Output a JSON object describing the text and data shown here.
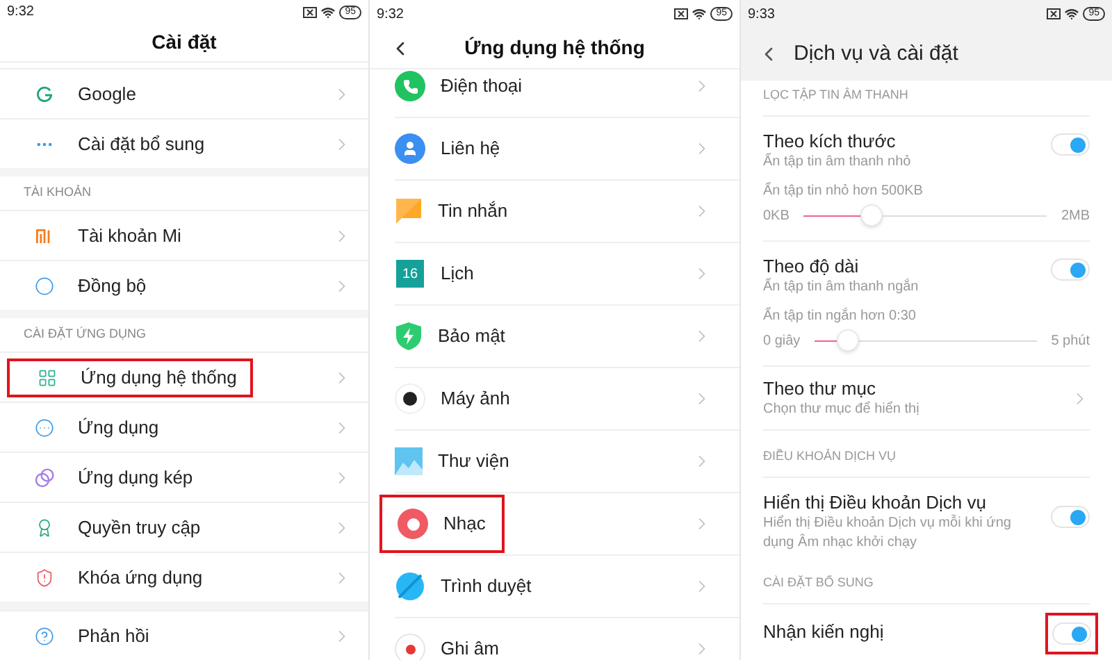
{
  "settings_screen": {
    "status_bar": {
      "time": "9:32",
      "battery": "95"
    },
    "title": "Cài đặt",
    "groups": [
      {
        "items": [
          {
            "label": "Google",
            "highlighted": false
          },
          {
            "label": "Cài đặt bổ sung",
            "highlighted": false
          }
        ]
      },
      {
        "header": "TÀI KHOẢN",
        "items": [
          {
            "label": "Tài khoản Mi",
            "highlighted": false
          },
          {
            "label": "Đồng bộ",
            "highlighted": false
          }
        ]
      },
      {
        "header": "CÀI ĐẶT ỨNG DỤNG",
        "items": [
          {
            "label": "Ứng dụng hệ thống",
            "highlighted": true
          },
          {
            "label": "Ứng dụng",
            "highlighted": false
          },
          {
            "label": "Ứng dụng kép",
            "highlighted": false
          },
          {
            "label": "Quyền truy cập",
            "highlighted": false
          },
          {
            "label": "Khóa ứng dụng",
            "highlighted": false
          }
        ]
      },
      {
        "items": [
          {
            "label": "Phản hồi",
            "highlighted": false
          }
        ]
      }
    ]
  },
  "system_apps_screen": {
    "status_bar": {
      "time": "9:32",
      "battery": "95"
    },
    "title": "Ứng dụng hệ thống",
    "items": [
      {
        "label": "Điện thoại",
        "highlighted": false
      },
      {
        "label": "Liên hệ",
        "highlighted": false
      },
      {
        "label": "Tin nhắn",
        "highlighted": false
      },
      {
        "label": "Lịch",
        "icon_text": "16",
        "highlighted": false
      },
      {
        "label": "Bảo mật",
        "highlighted": false
      },
      {
        "label": "Máy ảnh",
        "highlighted": false
      },
      {
        "label": "Thư viện",
        "highlighted": false
      },
      {
        "label": "Nhạc",
        "highlighted": true
      },
      {
        "label": "Trình duyệt",
        "highlighted": false
      },
      {
        "label": "Ghi âm",
        "highlighted": false
      }
    ]
  },
  "music_settings_screen": {
    "status_bar": {
      "time": "9:33",
      "battery": "95"
    },
    "title": "Dịch vụ và cài đặt",
    "rows": [
      {
        "kind": "section",
        "text": "LỌC TẬP TIN ÂM THANH"
      },
      {
        "kind": "toggle",
        "title": "Theo kích thước",
        "subtitle": "Ẩn tập tin âm thanh nhỏ",
        "on": true,
        "highlighted": false
      },
      {
        "kind": "slider",
        "caption": "Ẩn tập tin nhỏ hơn 500KB",
        "min_label": "0KB",
        "max_label": "2MB",
        "level": 0.28
      },
      {
        "kind": "toggle",
        "title": "Theo độ dài",
        "subtitle": "Ẩn tập tin âm thanh ngắn",
        "on": true,
        "highlighted": false
      },
      {
        "kind": "slider",
        "caption": "Ẩn tập tin ngắn hơn 0:30",
        "min_label": "0 giây",
        "max_label": "5 phút",
        "level": 0.15
      },
      {
        "kind": "link",
        "title": "Theo thư mục",
        "subtitle": "Chọn thư mục để hiển thị"
      },
      {
        "kind": "section",
        "text": "ĐIỀU KHOẢN DỊCH VỤ"
      },
      {
        "kind": "toggle",
        "title": "Hiển thị Điều khoản Dịch vụ",
        "subtitle": "Hiển thị Điều khoản Dịch vụ mỗi khi ứng dụng Âm nhạc khởi chạy",
        "on": true,
        "highlighted": false
      },
      {
        "kind": "section",
        "text": "CÀI ĐẶT BỔ SUNG"
      },
      {
        "kind": "toggle",
        "title": "Nhận kiến nghị",
        "on": true,
        "highlighted": true
      }
    ]
  }
}
